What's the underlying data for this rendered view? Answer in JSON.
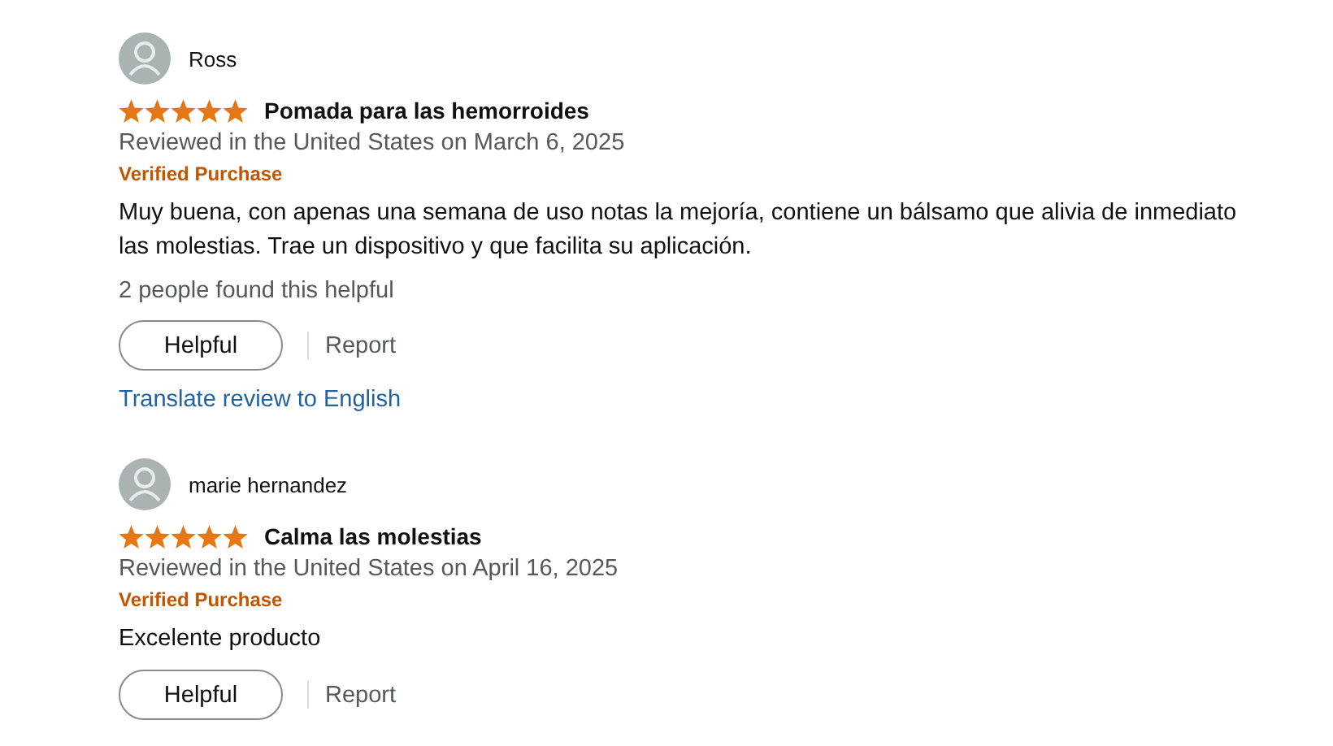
{
  "reviews": [
    {
      "reviewer": "Ross",
      "stars": 5,
      "title": "Pomada para las hemorroides",
      "meta": "Reviewed in the United States on March 6, 2025",
      "badge": "Verified Purchase",
      "body": [
        "Muy buena, con apenas una semana de uso notas la mejoría, contiene un bálsamo que alivia de inmediato",
        "las molestias. Trae un dispositivo y que facilita su aplicación."
      ],
      "helpful_count": "2 people found this helpful",
      "helpful_button": "Helpful",
      "report": "Report",
      "translate": "Translate review to English"
    },
    {
      "reviewer": "marie hernandez",
      "stars": 5,
      "title": "Calma las molestias",
      "meta": "Reviewed in the United States on April 16, 2025",
      "badge": "Verified Purchase",
      "body": [
        "Excelente producto"
      ],
      "helpful_button": "Helpful",
      "report": "Report"
    }
  ]
}
